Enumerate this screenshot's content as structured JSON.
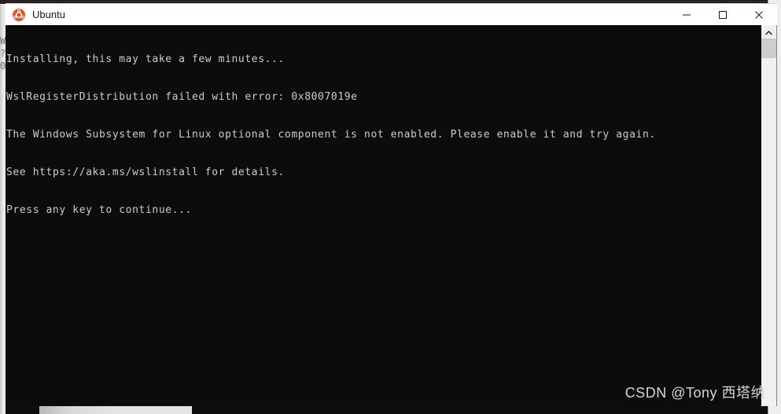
{
  "window": {
    "title": "Ubuntu",
    "icon": "ubuntu-logo-icon",
    "controls": {
      "minimize_label": "Minimize",
      "maximize_label": "Maximize",
      "close_label": "Close"
    }
  },
  "console": {
    "background_color": "#0c0c0c",
    "text_color": "#cccccc",
    "lines": [
      "Installing, this may take a few minutes...",
      "WslRegisterDistribution failed with error: 0x8007019e",
      "The Windows Subsystem for Linux optional component is not enabled. Please enable it and try again.",
      "See https://aka.ms/wslinstall for details.",
      "Press any key to continue..."
    ],
    "error_code": "0x8007019e",
    "help_url": "https://aka.ms/wslinstall"
  },
  "scrollbar": {
    "orientation": "vertical",
    "up_arrow": "chevron-up-icon",
    "thumb_position": "near-top"
  },
  "background": {
    "ghost_text": "W\n?\n0"
  },
  "watermark": {
    "text": "CSDN @Tony 西塔纳"
  }
}
